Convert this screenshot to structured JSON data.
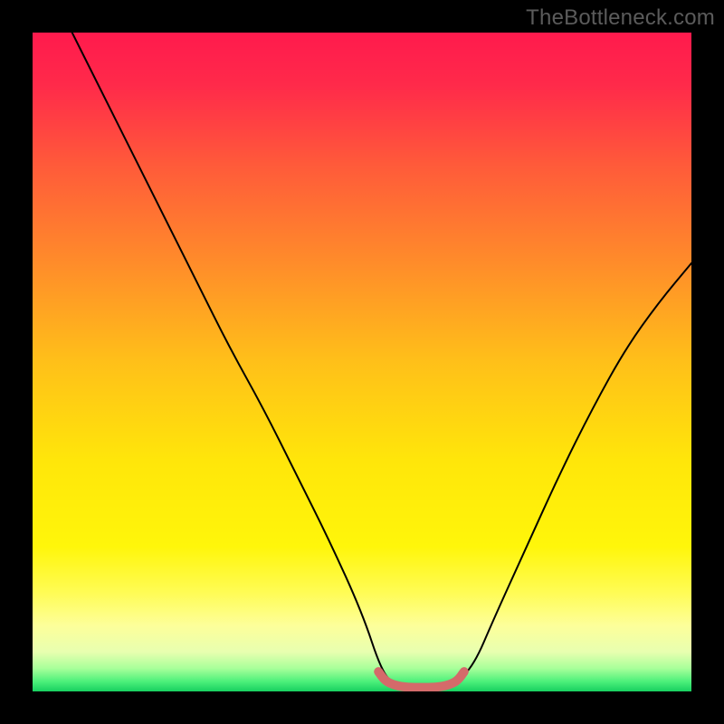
{
  "watermark": "TheBottleneck.com",
  "gradient_stops": [
    {
      "offset": 0.0,
      "color": "#ff1a4d"
    },
    {
      "offset": 0.08,
      "color": "#ff2a4a"
    },
    {
      "offset": 0.2,
      "color": "#ff5a3a"
    },
    {
      "offset": 0.35,
      "color": "#ff8c2a"
    },
    {
      "offset": 0.5,
      "color": "#ffc019"
    },
    {
      "offset": 0.65,
      "color": "#ffe60a"
    },
    {
      "offset": 0.78,
      "color": "#fff60a"
    },
    {
      "offset": 0.85,
      "color": "#fffc55"
    },
    {
      "offset": 0.9,
      "color": "#fdff9a"
    },
    {
      "offset": 0.94,
      "color": "#e8ffb0"
    },
    {
      "offset": 0.965,
      "color": "#a8ff9a"
    },
    {
      "offset": 0.985,
      "color": "#4cf07a"
    },
    {
      "offset": 1.0,
      "color": "#18d060"
    }
  ],
  "chart_data": {
    "type": "line",
    "title": "",
    "xlabel": "",
    "ylabel": "",
    "xlim": [
      0,
      100
    ],
    "ylim": [
      0,
      100
    ],
    "series": [
      {
        "name": "bottleneck-curve",
        "x": [
          6,
          10,
          15,
          20,
          25,
          30,
          35,
          40,
          45,
          50,
          53,
          55,
          58,
          62,
          64,
          67,
          70,
          75,
          80,
          85,
          90,
          95,
          100
        ],
        "values": [
          100,
          92,
          82,
          72,
          62,
          52,
          43,
          33,
          23,
          12,
          3,
          1,
          0.5,
          0.5,
          1,
          4,
          11,
          22,
          33,
          43,
          52,
          59,
          65
        ]
      },
      {
        "name": "highlight-band",
        "x": [
          52.5,
          53.5,
          55,
          57,
          59,
          61,
          63,
          64.5,
          65.5
        ],
        "values": [
          3.0,
          1.6,
          0.9,
          0.6,
          0.6,
          0.6,
          0.9,
          1.6,
          3.0
        ]
      }
    ],
    "highlight_color": "#d46a6a",
    "curve_color": "#000000"
  }
}
